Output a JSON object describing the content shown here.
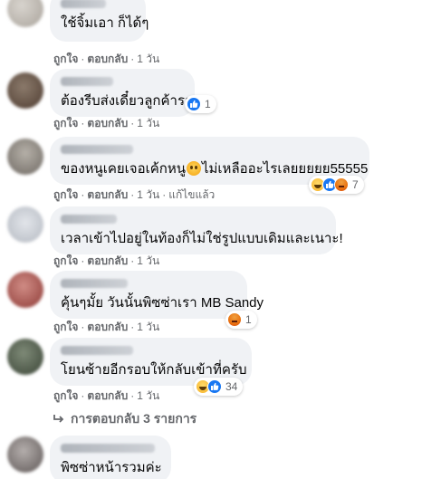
{
  "actions": {
    "like": "ถูกใจ",
    "reply": "ตอบกลับ",
    "edited": "แก้ไขแล้ว"
  },
  "comments": [
    {
      "text": "ใช้จิ้มเอา ก็ได้ๆ",
      "time": "1 วัน",
      "reactions": null,
      "avatar_color": "#b7b2aa"
    },
    {
      "text": "ต้องรีบส่งเดี๋ยวลูกค้ารอ",
      "time": "1 วัน",
      "reactions": {
        "count": "1",
        "types": [
          "like"
        ]
      },
      "avatar_color": "#6f5a4c"
    },
    {
      "text_before": "ของหนูเคยเจอเค้กหนู",
      "text_after": "ไม่เหลืออะไรเลยยยยย55555",
      "time": "1 วัน",
      "edited": true,
      "reactions": {
        "count": "7",
        "types": [
          "haha",
          "like",
          "angry"
        ]
      },
      "avatar_color": "#8f8a83"
    },
    {
      "text": "เวลาเข้าไปอยู่ในท้องก็ไม่ใช่รูปแบบเดิมและเนาะ!",
      "time": "1 วัน",
      "reactions": null,
      "avatar_color": "#c7cbd2"
    },
    {
      "text": "คุ้นๆมั้ย วันนั้นพิซซ่าเรา MB Sandy",
      "time": "1 วัน",
      "reactions": {
        "count": "1",
        "types": [
          "angry"
        ]
      },
      "avatar_color": "#a3544f"
    },
    {
      "text": "โยนซ้ายอีกรอบให้กลับเข้าที่ครับ",
      "time": "1 วัน",
      "reactions": {
        "count": "34",
        "types": [
          "haha",
          "like"
        ]
      },
      "avatar_color": "#55604f"
    },
    {
      "text": "พิซซ่าหน้ารวมค่ะ",
      "avatar_color": "#8a8584"
    }
  ],
  "replies_link": "การตอบกลับ 3 รายการ",
  "icons": {
    "reply_arrow": "reply-arrow-icon",
    "like": "like-reaction-icon",
    "haha": "haha-reaction-icon",
    "angry": "angry-reaction-icon",
    "emoji": "grinning-emoji-icon"
  },
  "colors": {
    "bubble": "#f0f2f5",
    "meta": "#65676b",
    "like_blue": "#1877f2"
  }
}
